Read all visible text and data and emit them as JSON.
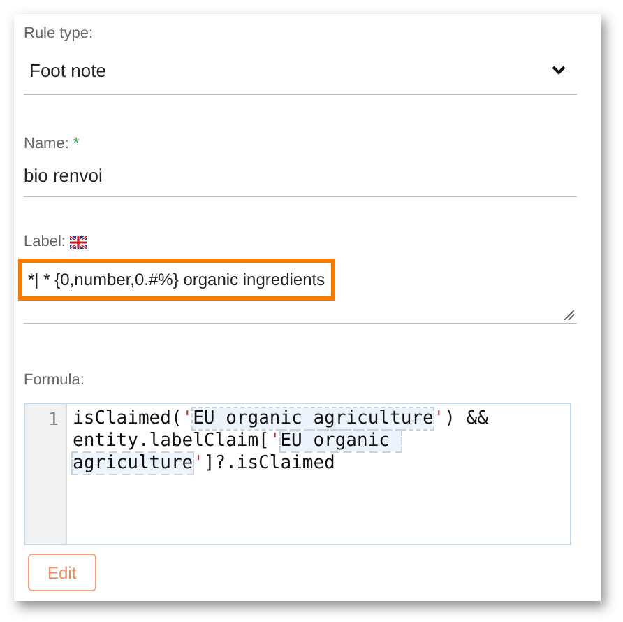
{
  "rule_type": {
    "label": "Rule type:",
    "value": "Foot note"
  },
  "name": {
    "label": "Name:",
    "required_mark": "*",
    "value": "bio renvoi"
  },
  "label": {
    "label": "Label:",
    "value": "*| * {0,number,0.#%} organic ingredients",
    "highlighted": true
  },
  "formula": {
    "label": "Formula:",
    "line_number": "1",
    "tokens": [
      {
        "kind": "plain",
        "text": "isClaimed("
      },
      {
        "kind": "quote",
        "text": "'"
      },
      {
        "kind": "string",
        "text": "EU organic agriculture"
      },
      {
        "kind": "quote",
        "text": "'"
      },
      {
        "kind": "plain",
        "text": ") && entity.labelClaim["
      },
      {
        "kind": "quote",
        "text": "'"
      },
      {
        "kind": "string",
        "text": "EU organic agriculture"
      },
      {
        "kind": "quote",
        "text": "'"
      },
      {
        "kind": "plain",
        "text": "]?.isClaimed"
      }
    ]
  },
  "buttons": [
    {
      "label": "Edit"
    }
  ]
}
